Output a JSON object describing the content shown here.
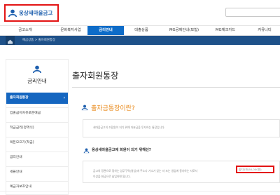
{
  "header": {
    "logo_text": "웅상새마을금고",
    "brand_color": "#1d5fae",
    "highlight_color": "#e31414"
  },
  "nav": {
    "items": [
      "금고소개",
      "문화복지사업",
      "금리안내",
      "대출상품",
      "MG공제안내(보험)",
      "MG체크카드",
      "커뮤니티"
    ],
    "active_index": 2,
    "active_color": "#0e6cc8"
  },
  "breadcrumb": {
    "text": "예금상품  >  출자회원통장"
  },
  "sidebar": {
    "title": "금리안내",
    "items": [
      "출자회원통장",
      "입출금이자유로운예금",
      "적금금리(정액식)",
      "목돈모으기(적금)",
      "금리안내",
      "세율안내",
      "예금자보호안내"
    ],
    "active_index": 0,
    "active_color": "#1566c0"
  },
  "content": {
    "page_title": "출자회원통장",
    "section1": {
      "heading": "출자금통장이란?",
      "text": "새마을금고의 조합원이 되기 위해 자본금을 투자하는 통장입니다.",
      "accent_color": "#e98a1b"
    },
    "section2": {
      "heading": "웅상새마을금고에 회원이 되기 위해선?",
      "line1_before": "금고의 정관으로 정하는 업무구역(영업)에 주소나 거소가 있는 자 또는 생업에 종사하는 자로서",
      "line1_highlight": "출자1좌(50,000원)",
      "line2": "이상을 현금으로 납입하면 됩니다."
    }
  }
}
